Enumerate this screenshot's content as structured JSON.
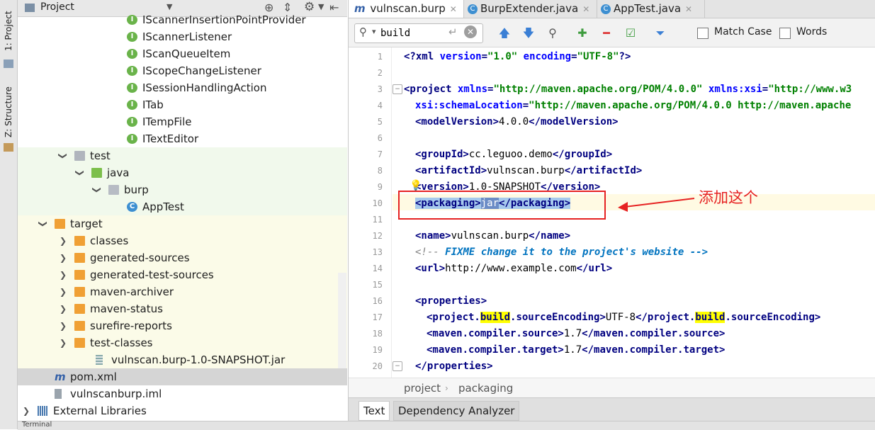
{
  "toolstrip": {
    "project_tab": "1: Project",
    "structure_tab": "Z: Structure"
  },
  "project_panel": {
    "title": "Project",
    "tree": [
      {
        "label": "IScannerInsertionPointProvider",
        "icon": "interface-icon",
        "indent": 1
      },
      {
        "label": "IScannerListener",
        "icon": "interface-icon",
        "indent": 1
      },
      {
        "label": "IScanQueueItem",
        "icon": "interface-icon",
        "indent": 1
      },
      {
        "label": "IScopeChangeListener",
        "icon": "interface-icon",
        "indent": 1
      },
      {
        "label": "ISessionHandlingAction",
        "icon": "interface-icon",
        "indent": 1
      },
      {
        "label": "ITab",
        "icon": "interface-icon",
        "indent": 1
      },
      {
        "label": "ITempFile",
        "icon": "interface-icon",
        "indent": 1
      },
      {
        "label": "ITextEditor",
        "icon": "interface-icon",
        "indent": 1
      },
      {
        "label": "test",
        "icon": "folder-icon",
        "indent": 2,
        "expanded": true
      },
      {
        "label": "java",
        "icon": "source-folder-icon",
        "indent": 3,
        "expanded": true
      },
      {
        "label": "burp",
        "icon": "package-icon",
        "indent": 4,
        "expanded": true
      },
      {
        "label": "AppTest",
        "icon": "class-icon",
        "indent": 5
      },
      {
        "label": "target",
        "icon": "excluded-folder-icon",
        "indent": 0,
        "expanded": true
      },
      {
        "label": "classes",
        "icon": "excluded-folder-icon",
        "indent": 1,
        "expanded": false
      },
      {
        "label": "generated-sources",
        "icon": "excluded-folder-icon",
        "indent": 1,
        "expanded": false
      },
      {
        "label": "generated-test-sources",
        "icon": "excluded-folder-icon",
        "indent": 1,
        "expanded": false
      },
      {
        "label": "maven-archiver",
        "icon": "excluded-folder-icon",
        "indent": 1,
        "expanded": false
      },
      {
        "label": "maven-status",
        "icon": "excluded-folder-icon",
        "indent": 1,
        "expanded": false
      },
      {
        "label": "surefire-reports",
        "icon": "excluded-folder-icon",
        "indent": 1,
        "expanded": false
      },
      {
        "label": "test-classes",
        "icon": "excluded-folder-icon",
        "indent": 1,
        "expanded": false
      },
      {
        "label": "vulnscan.burp-1.0-SNAPSHOT.jar",
        "icon": "jar-icon",
        "indent": 1
      },
      {
        "label": "pom.xml",
        "icon": "maven-icon",
        "indent": 0,
        "selected": true
      },
      {
        "label": "vulnscanburp.iml",
        "icon": "iml-icon",
        "indent": 0
      },
      {
        "label": "External Libraries",
        "icon": "libraries-icon",
        "indent": -1,
        "expanded": false
      }
    ]
  },
  "editor": {
    "tabs": [
      {
        "label": "vulnscan.burp",
        "active": true
      },
      {
        "label": "BurpExtender.java",
        "active": false
      },
      {
        "label": "AppTest.java",
        "active": false
      }
    ],
    "search": {
      "value": "build",
      "match_case_label": "Match Case",
      "words_label": "Words"
    },
    "lines": [
      "1",
      "2",
      "3",
      "4",
      "5",
      "6",
      "7",
      "8",
      "9",
      "10",
      "11",
      "12",
      "13",
      "14",
      "15",
      "16",
      "17",
      "18",
      "19",
      "20"
    ],
    "code": {
      "l1_open": "<?",
      "l1_xml": "xml",
      "l1_a1": "version",
      "l1_v1": "\"1.0\"",
      "l1_a2": "encoding",
      "l1_v2": "\"UTF-8\"",
      "l1_close": "?>",
      "l3_tag": "<project",
      "l3_a1": "xmlns",
      "l3_v1": "\"http://maven.apache.org/POM/4.0.0\"",
      "l3_a2": "xmlns:xsi",
      "l3_v2": "\"http://www.w3",
      "l4_a": "xsi:schemaLocation",
      "l4_v": "\"http://maven.apache.org/POM/4.0.0 http://maven.apache",
      "l5_open": "<modelVersion>",
      "l5_text": "4.0.0",
      "l5_close": "</modelVersion>",
      "l7_open": "<groupId>",
      "l7_text": "cc.leguoo.demo",
      "l7_close": "</groupId>",
      "l8_open": "<artifactId>",
      "l8_text": "vulnscan.burp",
      "l8_close": "</artifactId>",
      "l9_open": "<version>",
      "l9_text": "1.0-SNAPSHOT",
      "l9_close": "</version>",
      "l10_open": "<packaging>",
      "l10_text": "jar",
      "l10_close": "</packaging>",
      "l12_open": "<name>",
      "l12_text": "vulnscan.burp",
      "l12_close": "</name>",
      "l13_start": "<!-- ",
      "l13_fixme": "FIXME",
      "l13_rest": " change it to the project's website -->",
      "l14_open": "<url>",
      "l14_text": "http://www.example.com",
      "l14_close": "</url>",
      "l16_open": "<properties>",
      "l17_open1": "<project.",
      "l17_build": "build",
      "l17_open2": ".sourceEncoding>",
      "l17_text": "UTF-8",
      "l17_close1": "</project.",
      "l17_close2": ".sourceEncoding>",
      "l18_open": "<maven.compiler.source>",
      "l18_text": "1.7",
      "l18_close": "</maven.compiler.source>",
      "l19_open": "<maven.compiler.target>",
      "l19_text": "1.7",
      "l19_close": "</maven.compiler.target>",
      "l20_close": "</properties>"
    },
    "breadcrumb": [
      "project",
      "packaging"
    ],
    "bottom_tabs": [
      "Text",
      "Dependency Analyzer"
    ]
  },
  "annotation": {
    "text": "添加这个",
    "color": "#e62222"
  },
  "statusbar": {
    "terminal_label": "Terminal"
  }
}
